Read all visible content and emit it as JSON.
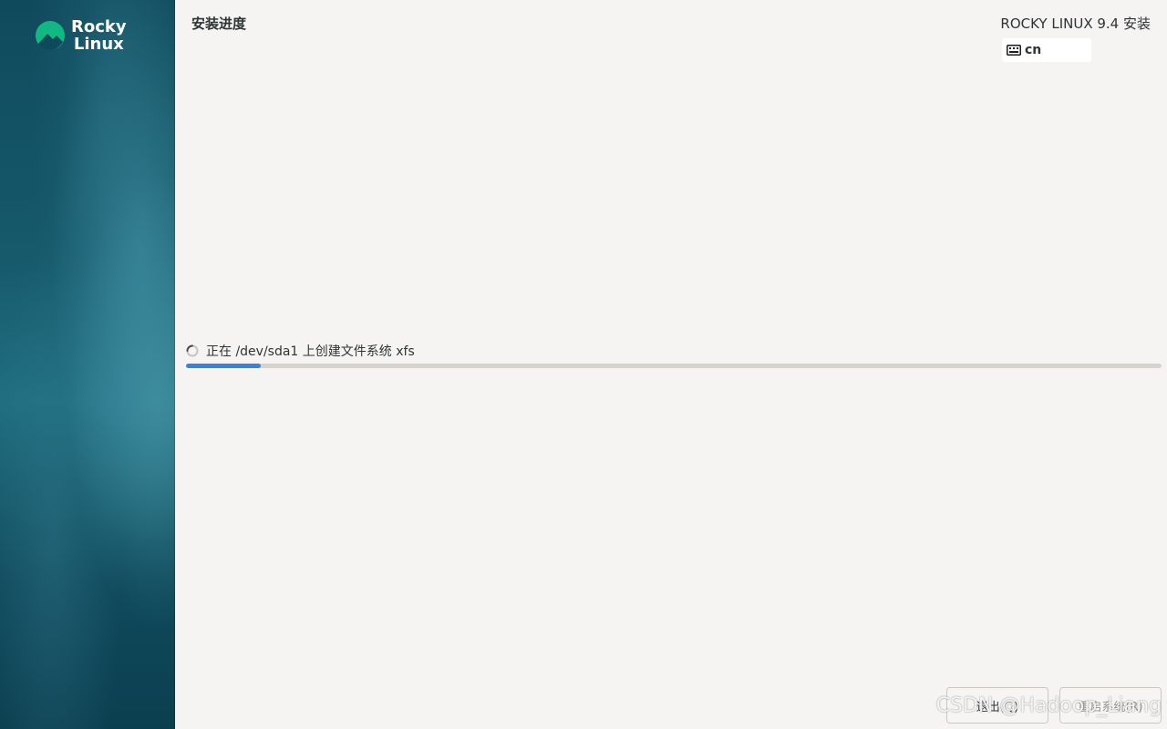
{
  "sidebar": {
    "logo": {
      "line1": "Rocky",
      "line2": "Linux",
      "icon": "rocky-logo-icon",
      "color": "#10b981"
    }
  },
  "header": {
    "title": "安装进度",
    "product": "ROCKY LINUX 9.4 安装",
    "keyboard_layout": "cn"
  },
  "progress": {
    "status_text": "正在 /dev/sda1 上创建文件系统 xfs",
    "fraction": 0.077,
    "accent": "#3584e4"
  },
  "buttons": {
    "quit_label": "退出(Q)",
    "reboot_label": "重启系统(R)"
  },
  "watermark": "CSDN @Hadoop_Liang"
}
